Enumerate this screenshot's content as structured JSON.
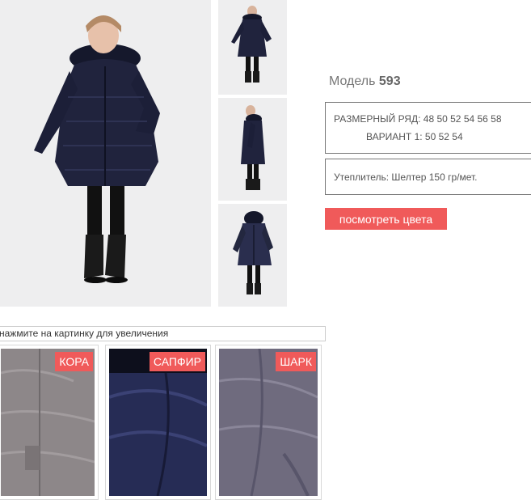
{
  "product": {
    "model_label": "Модель",
    "model_number": "593",
    "sizes_line": "РАЗМЕРНЫЙ РЯД: 48 50 52 54 56 58",
    "variant_line": "ВАРИАНТ 1: 50 52 54",
    "insulation_line": "Утеплитель: Шелтер 150 гр/мет.",
    "view_colors_button": "посмотреть цвета"
  },
  "gallery": {
    "main_photo_icon": "woman-in-coat-front",
    "thumbnails": [
      {
        "icon": "woman-in-coat-thumb-front"
      },
      {
        "icon": "woman-in-coat-thumb-side"
      },
      {
        "icon": "woman-in-coat-thumb-back"
      }
    ]
  },
  "colors": {
    "hint": "нажмите на картинку для увеличения",
    "swatches": [
      {
        "name": "КОРА",
        "fabric_color": "#8d8789"
      },
      {
        "name": "САПФИР",
        "fabric_color": "#262c55"
      },
      {
        "name": "ШАРК",
        "fabric_color": "#6f6b7e"
      }
    ],
    "accent": "#f05a5a"
  }
}
